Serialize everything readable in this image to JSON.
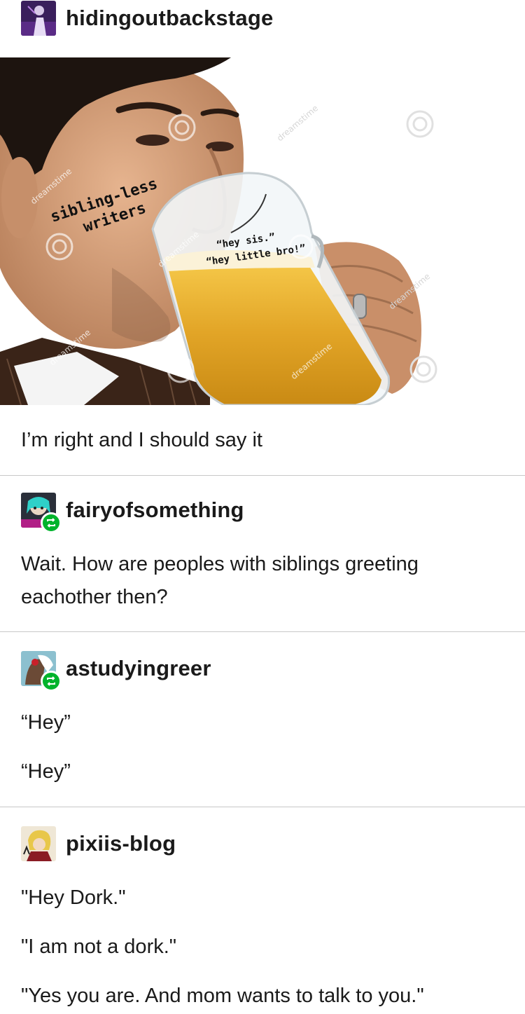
{
  "posts": [
    {
      "username": "hidingoutbackstage",
      "lines": [
        "I’m right and I should say it"
      ]
    },
    {
      "username": "fairyofsomething",
      "reblog": true,
      "lines": [
        "Wait. How are peoples with siblings greeting eachother then?"
      ]
    },
    {
      "username": "astudyingreer",
      "reblog": true,
      "lines": [
        "“Hey”",
        "“Hey”"
      ]
    },
    {
      "username": "pixiis-blog",
      "lines": [
        "\"Hey Dork.\"",
        "\"I am not a dork.\"",
        "\"Yes you are. And mom wants to talk to you.\""
      ]
    }
  ],
  "meme": {
    "label_person_line1": "sibling-less",
    "label_person_line2": "writers",
    "label_glass_line1": "“hey sis.”",
    "label_glass_line2": "“hey little bro!”",
    "watermark": "dreamstime"
  },
  "colors": {
    "reblog_green": "#00b32c",
    "divider": "#c8c8c8"
  }
}
